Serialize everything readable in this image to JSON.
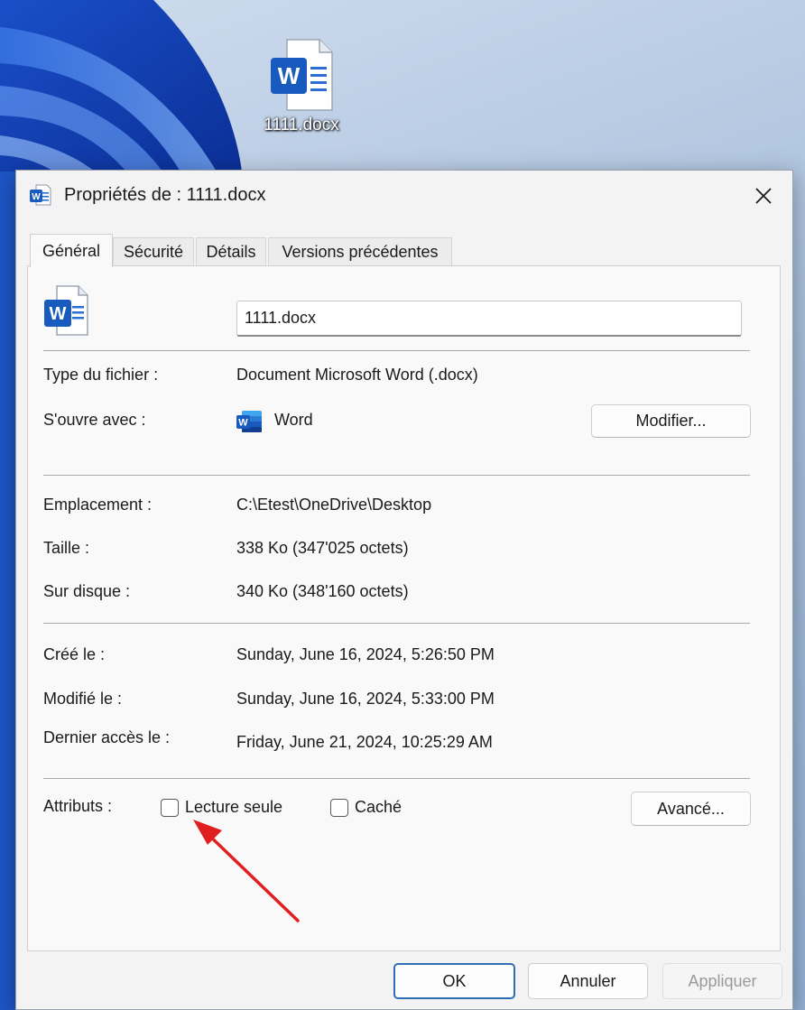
{
  "desktop": {
    "file_label": "1111.docx",
    "file_icon": "word-document-icon"
  },
  "dialog": {
    "title": "Propriétés de : 1111.docx",
    "title_icon": "word-icon",
    "close_icon": "close-icon",
    "tabs": [
      {
        "label": "Général",
        "active": true
      },
      {
        "label": "Sécurité",
        "active": false
      },
      {
        "label": "Détails",
        "active": false
      },
      {
        "label": "Versions précédentes",
        "active": false
      }
    ],
    "general": {
      "file_name": "1111.docx",
      "type_label": "Type du fichier :",
      "type_value": "Document Microsoft Word (.docx)",
      "opens_with_label": "S'ouvre avec :",
      "opens_with_value": "Word",
      "change_button": "Modifier...",
      "location_label": "Emplacement :",
      "location_value": "C:\\Etest\\OneDrive\\Desktop",
      "size_label": "Taille :",
      "size_value": "338 Ko (347'025 octets)",
      "disk_label": "Sur disque :",
      "disk_value": "340 Ko (348'160 octets)",
      "created_label": "Créé le :",
      "created_value": "Sunday, June 16, 2024, 5:26:50 PM",
      "modified_label": "Modifié le :",
      "modified_value": "Sunday, June 16, 2024, 5:33:00 PM",
      "accessed_label": "Dernier accès le :",
      "accessed_value": "Friday, June 21, 2024, 10:25:29 AM",
      "attributes_label": "Attributs :",
      "readonly_label": "Lecture seule",
      "readonly_checked": false,
      "hidden_label": "Caché",
      "hidden_checked": false,
      "advanced_button": "Avancé..."
    },
    "footer": {
      "ok": "OK",
      "cancel": "Annuler",
      "apply": "Appliquer"
    }
  },
  "colors": {
    "accent": "#2f6db5",
    "word_blue": "#185abd",
    "annotation_arrow": "#e02020"
  }
}
